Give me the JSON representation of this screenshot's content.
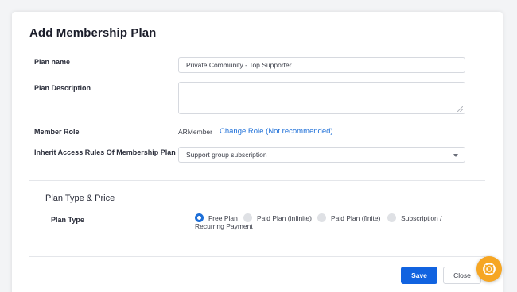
{
  "modal": {
    "title": "Add Membership Plan"
  },
  "form": {
    "plan_name": {
      "label": "Plan name",
      "value": "Private Community - Top Supporter"
    },
    "plan_description": {
      "label": "Plan Description",
      "value": ""
    },
    "member_role": {
      "label": "Member Role",
      "value": "ARMember",
      "change_link": "Change Role (Not recommended)"
    },
    "inherit_access": {
      "label": "Inherit Access Rules Of Membership Plan",
      "selected": "Support group subscription"
    }
  },
  "plan_type_price": {
    "section_title": "Plan Type & Price",
    "plan_type_label": "Plan Type",
    "options": [
      {
        "label": "Free Plan",
        "checked": true
      },
      {
        "label": "Paid Plan (infinite)",
        "checked": false
      },
      {
        "label": "Paid Plan (finite)",
        "checked": false
      },
      {
        "label": "Subscription /",
        "checked": false
      }
    ],
    "option_wrap_text": "Recurring Payment"
  },
  "footer": {
    "save_label": "Save",
    "close_label": "Close"
  },
  "colors": {
    "accent": "#1163e0",
    "link": "#1d6fd8",
    "help_button": "#f6a623"
  },
  "icons": {
    "help": "lifebuoy-icon",
    "dropdown": "chevron-down-icon",
    "resize": "resize-grip-icon"
  }
}
